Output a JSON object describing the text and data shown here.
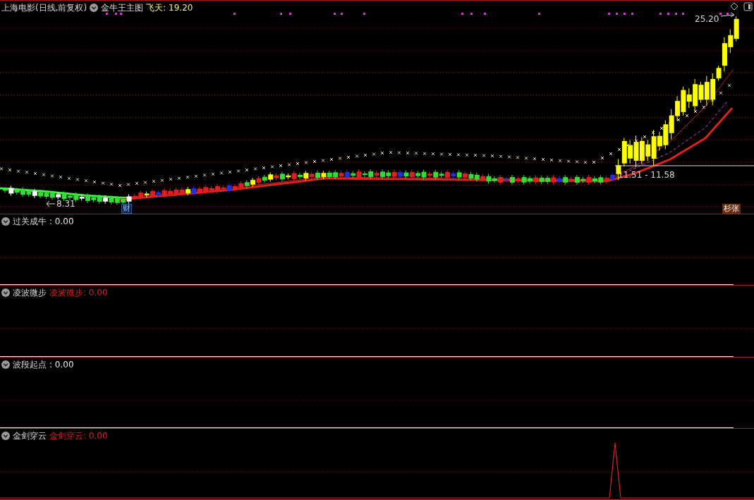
{
  "header": {
    "title": "上海电影(日线,前复权)",
    "indicator": "金牛王主图",
    "reading": "飞天: 19.20"
  },
  "main_chart": {
    "high_label": "25.20",
    "low_label": "8.31",
    "range_label": "11.51 - 11.58",
    "badge": "财",
    "tag": "杉张"
  },
  "panels": [
    {
      "name": "过关成牛",
      "reading": ": 0.00",
      "kind": "plain",
      "signal": false
    },
    {
      "name": "凌波微步",
      "reading": "凌波微步: 0.00",
      "kind": "highlight",
      "signal": false
    },
    {
      "name": "波段起点",
      "reading": ": 0.00",
      "kind": "plain",
      "signal": false
    },
    {
      "name": "金剑穿云",
      "reading": "金剑穿云: 0.00",
      "kind": "highlight",
      "signal": true
    }
  ]
}
